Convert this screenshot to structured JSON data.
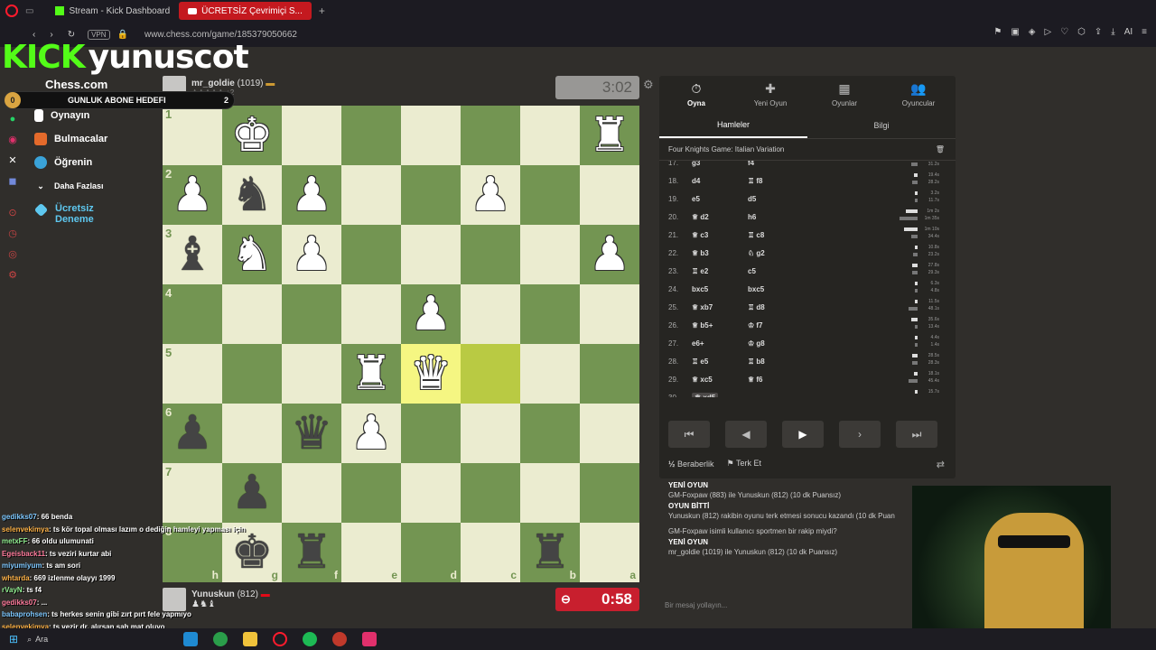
{
  "browser": {
    "tabs": [
      {
        "label": "Stream - Kick Dashboard"
      },
      {
        "label": "ÜCRETSİZ Çevrimiçi S..."
      }
    ],
    "vpn": "VPN",
    "url": "www.chess.com/game/185379050662",
    "ai": "AI"
  },
  "overlay": {
    "brand": "KICK",
    "streamer": "yunuscot",
    "sub_goal": {
      "current": "0",
      "label": "GUNLUK ABONE HEDEFI",
      "target": "2"
    }
  },
  "sidebar": {
    "logo": "Chess.com",
    "items": [
      {
        "label": "Oynayın"
      },
      {
        "label": "Bulmacalar"
      },
      {
        "label": "Öğrenin"
      },
      {
        "label": "Daha Fazlası"
      },
      {
        "label": "Ücretsiz Deneme"
      }
    ]
  },
  "top_player": {
    "name": "mr_goldie",
    "rating": "(1019)",
    "extra": "+2",
    "clock": "3:02"
  },
  "bottom_player": {
    "name": "Yunuskun",
    "rating": "(812)",
    "clock": "0:58"
  },
  "board": {
    "ranks": [
      "1",
      "2",
      "3",
      "4",
      "5",
      "6",
      "7",
      "8"
    ],
    "files": [
      "h",
      "g",
      "f",
      "e",
      "d",
      "c",
      "b",
      "a"
    ],
    "highlight": [
      "d5",
      "c5"
    ],
    "pieces": [
      {
        "sq": "g1",
        "p": "♚",
        "c": "w"
      },
      {
        "sq": "a1",
        "p": "♜",
        "c": "w"
      },
      {
        "sq": "h2",
        "p": "♟",
        "c": "w"
      },
      {
        "sq": "g2",
        "p": "♞",
        "c": "b"
      },
      {
        "sq": "f2",
        "p": "♟",
        "c": "w"
      },
      {
        "sq": "c2",
        "p": "♟",
        "c": "w"
      },
      {
        "sq": "h3",
        "p": "♝",
        "c": "b"
      },
      {
        "sq": "g3",
        "p": "♞",
        "c": "w"
      },
      {
        "sq": "f3",
        "p": "♟",
        "c": "w"
      },
      {
        "sq": "a3",
        "p": "♟",
        "c": "w"
      },
      {
        "sq": "d4",
        "p": "♟",
        "c": "w"
      },
      {
        "sq": "e5",
        "p": "♜",
        "c": "w"
      },
      {
        "sq": "d5",
        "p": "♛",
        "c": "w"
      },
      {
        "sq": "h6",
        "p": "♟",
        "c": "b"
      },
      {
        "sq": "f6",
        "p": "♛",
        "c": "b"
      },
      {
        "sq": "e6",
        "p": "♟",
        "c": "w"
      },
      {
        "sq": "g7",
        "p": "♟",
        "c": "b"
      },
      {
        "sq": "g8",
        "p": "♚",
        "c": "b"
      },
      {
        "sq": "f8",
        "p": "♜",
        "c": "b"
      },
      {
        "sq": "b8",
        "p": "♜",
        "c": "b"
      }
    ]
  },
  "panel": {
    "tabs": [
      {
        "label": "Oyna",
        "icon": "⏱"
      },
      {
        "label": "Yeni Oyun",
        "icon": "✚"
      },
      {
        "label": "Oyunlar",
        "icon": "▦"
      },
      {
        "label": "Oyuncular",
        "icon": "👥"
      }
    ],
    "subtabs": [
      "Hamleler",
      "Bilgi"
    ],
    "opening": "Four Knights Game: Italian Variation",
    "moves": [
      {
        "n": "17.",
        "w": "g3",
        "b": "f4",
        "tw": "",
        "tb": "31.2s"
      },
      {
        "n": "18.",
        "w": "d4",
        "b": "♖ f8",
        "tw": "19.4s",
        "tb": "28.2s"
      },
      {
        "n": "19.",
        "w": "e5",
        "b": "d5",
        "tw": "3.2s",
        "tb": "11.7s"
      },
      {
        "n": "20.",
        "w": "♕ d2",
        "b": "h6",
        "tw": "1m 2s",
        "tb": "1m 35s"
      },
      {
        "n": "21.",
        "w": "♕ c3",
        "b": "♖ c8",
        "tw": "1m 10s",
        "tb": "34.4s"
      },
      {
        "n": "22.",
        "w": "♕ b3",
        "b": "♘ g2",
        "tw": "10.8s",
        "tb": "23.2s"
      },
      {
        "n": "23.",
        "w": "♖ e2",
        "b": "c5",
        "tw": "27.8s",
        "tb": "29.3s"
      },
      {
        "n": "24.",
        "w": "bxc5",
        "b": "bxc5",
        "tw": "6.3s",
        "tb": "4.8s"
      },
      {
        "n": "25.",
        "w": "♕ xb7",
        "b": "♖ d8",
        "tw": "11.5s",
        "tb": "48.1s"
      },
      {
        "n": "26.",
        "w": "♕ b5+",
        "b": "♔ f7",
        "tw": "35.6s",
        "tb": "13.4s"
      },
      {
        "n": "27.",
        "w": "e6+",
        "b": "♔ g8",
        "tw": "4.4s",
        "tb": "1.4s"
      },
      {
        "n": "28.",
        "w": "♖ e5",
        "b": "♖ b8",
        "tw": "28.5s",
        "tb": "28.3s"
      },
      {
        "n": "29.",
        "w": "♕ xc5",
        "b": "♕ f6",
        "tw": "18.1s",
        "tb": "45.4s"
      },
      {
        "n": "30.",
        "w": "♕ xd5",
        "b": "",
        "tw": "15.7s",
        "tb": ""
      }
    ],
    "draw": "Beraberlik",
    "resign": "Terk Et"
  },
  "game_log": [
    {
      "head": "YENİ OYUN",
      "text": "GM-Foxpaw (883) ile Yunuskun (812) (10 dk Puansız)"
    },
    {
      "head": "OYUN BİTTİ",
      "text": "Yunuskun (812) rakibin oyunu terk etmesi sonucu kazandı (10 dk Puan"
    },
    {
      "head": "",
      "text": "GM-Foxpaw isimli kullanıcı sportmen bir rakip miydi?"
    },
    {
      "head": "YENİ OYUN",
      "text": "mr_goldie (1019) ile Yunuskun (812) (10 dk Puansız)"
    }
  ],
  "message_placeholder": "Bir mesaj yollayın...",
  "stream_chat": [
    {
      "user": "gedikks07",
      "msg": ": 66 benda"
    },
    {
      "user": "selenvekimya",
      "msg": ": ts kör topal olması lazım o dediğin hamleyi yapması için"
    },
    {
      "user": "metxFF",
      "msg": ": 66 oldu ulumunati"
    },
    {
      "user": "Egeisback11",
      "msg": ": ts veziri kurtar abi"
    },
    {
      "user": "miyumiyum",
      "msg": ": ts am sori"
    },
    {
      "user": "whtarda",
      "msg": ": 669 izlenme olayyı 1999"
    },
    {
      "user": "rVayN",
      "msg": ": ts f4"
    },
    {
      "user": "gedikks07",
      "msg": ": ..."
    },
    {
      "user": "babaprohsen",
      "msg": ": ts herkes senin gibi zırt pırt fele yapmıyo"
    },
    {
      "user": "selenvekimya",
      "msg": ": ts vezir dr. alırsan şah mat oluyo"
    },
    {
      "user": "canankopek_concirkinnn",
      "msg": ": ts yunus 1 dakkan kaldı ne hıçbi düşüm"
    }
  ],
  "taskbar": {
    "search": "Ara"
  },
  "colors": {
    "light_square": "#ebecd0",
    "dark_square": "#739552",
    "kick_green": "#53fc18",
    "clock_red": "#c81f2e"
  }
}
